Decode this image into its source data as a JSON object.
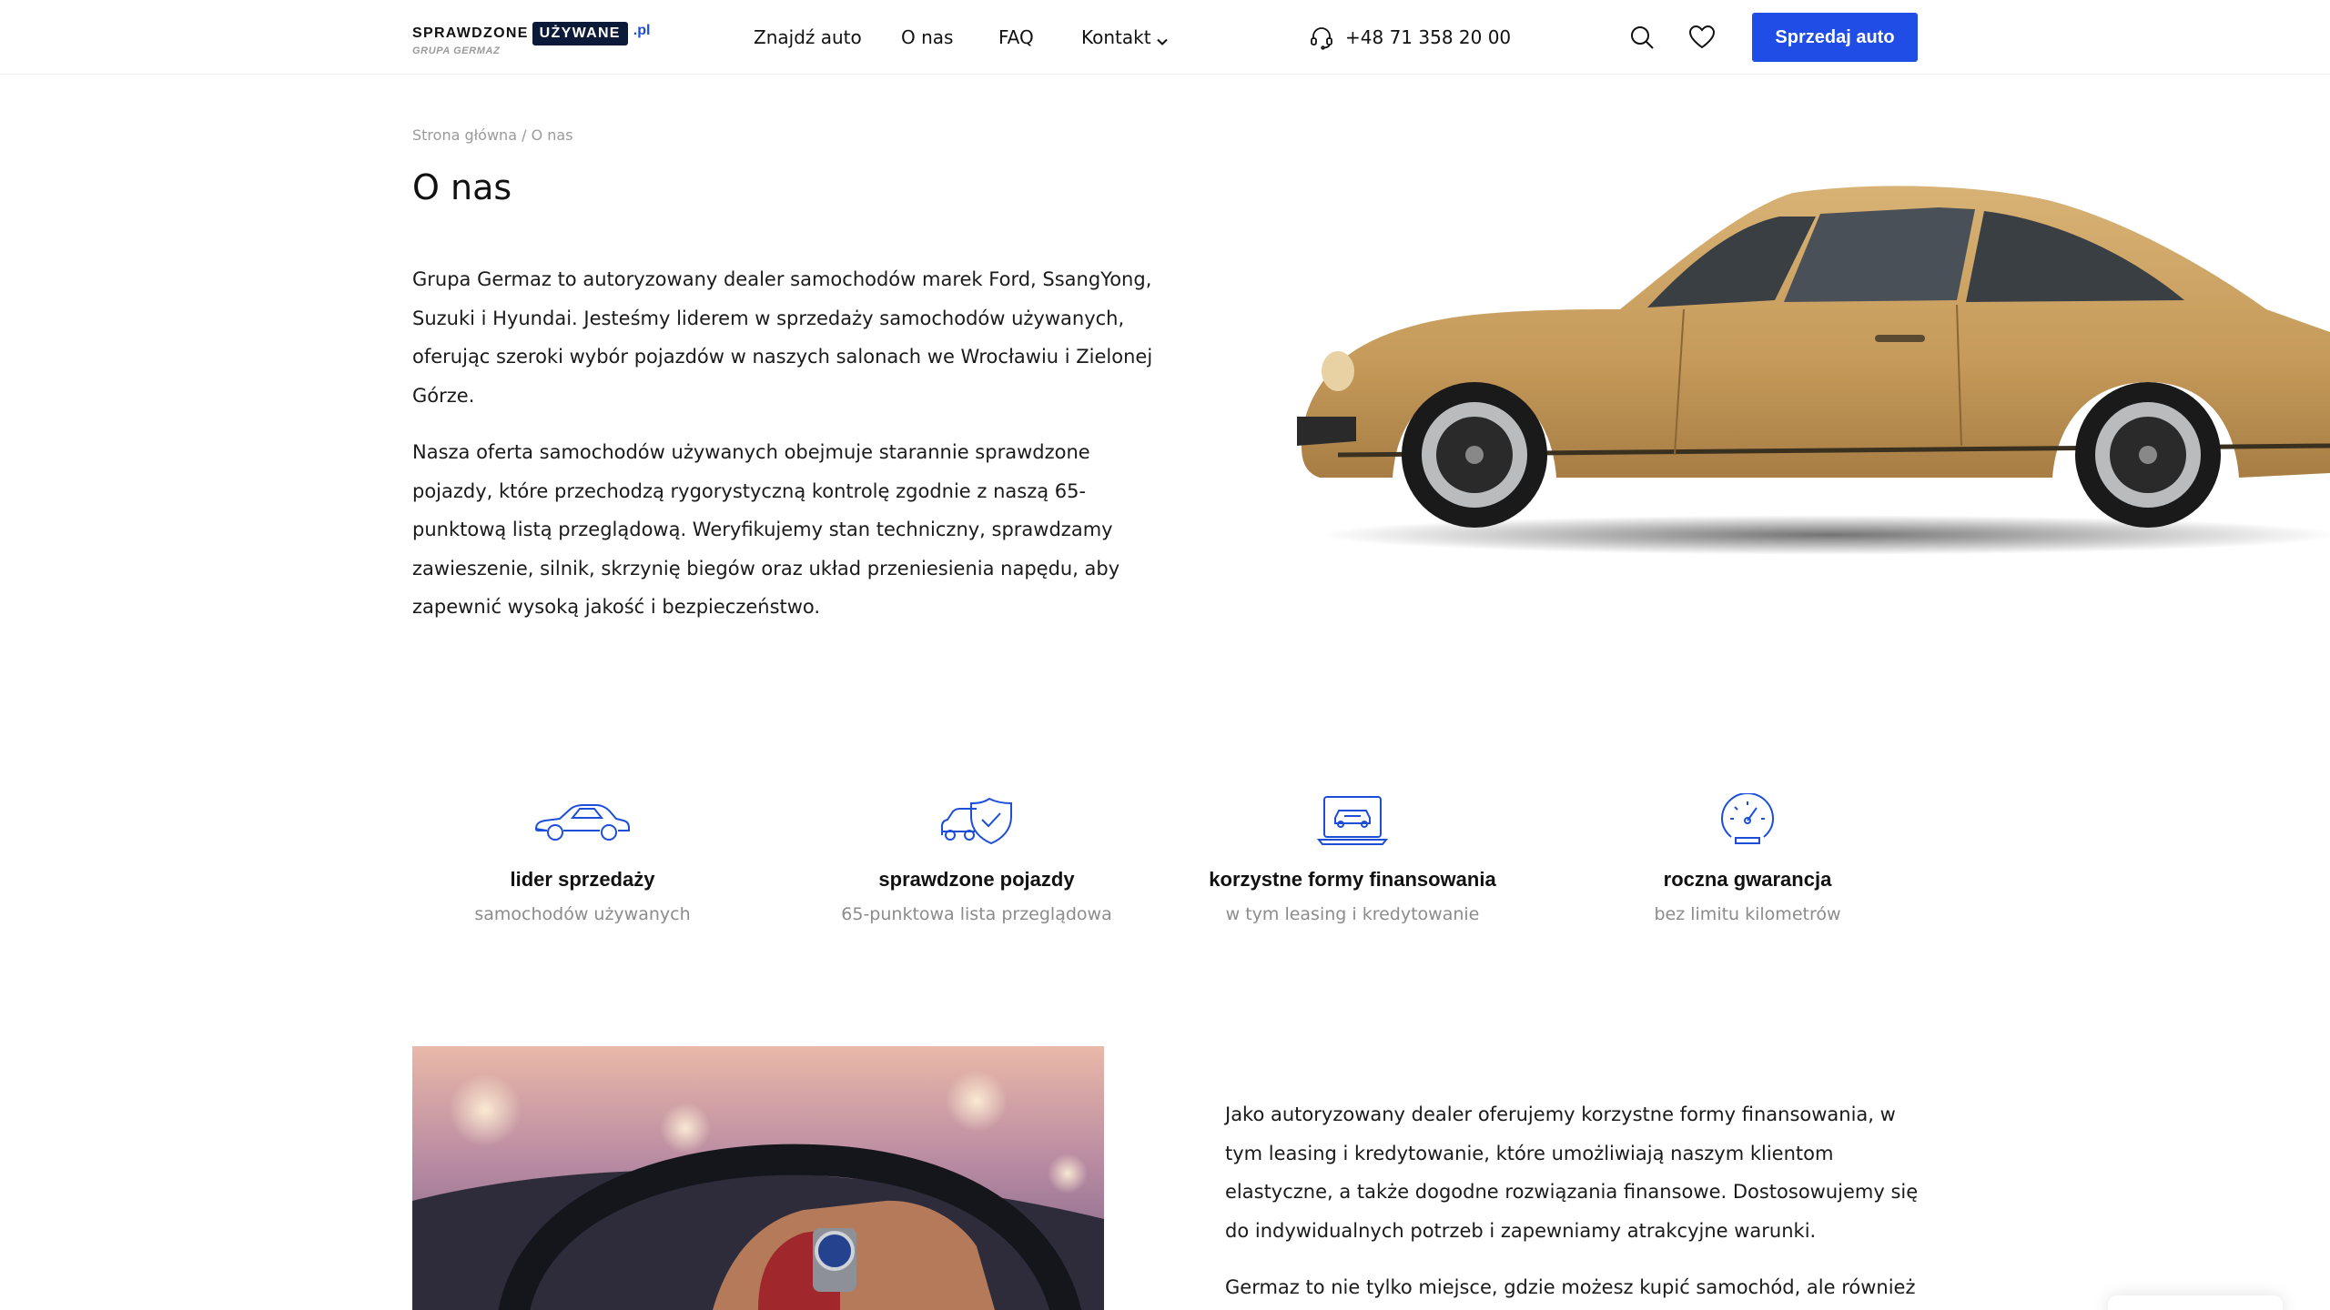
{
  "header": {
    "logo": {
      "part1": "SPRAWDZONE",
      "part2": "UŻYWANE",
      "part3": ".pl",
      "sub": "GRUPA GERMAZ"
    },
    "nav": [
      {
        "label": "Znajdź auto"
      },
      {
        "label": "O nas"
      },
      {
        "label": "FAQ"
      },
      {
        "label": "Kontakt"
      }
    ],
    "phone": "+48 71 358 20 00",
    "sell_label": "Sprzedaj auto",
    "icons": {
      "search": "search-icon",
      "favorites": "heart-icon",
      "phone": "headset-icon",
      "dropdown": "chevron-down-icon"
    }
  },
  "breadcrumb": "Strona główna / O nas",
  "title": "O nas",
  "intro": [
    "Grupa Germaz to autoryzowany dealer samochodów marek Ford, SsangYong, Suzuki i Hyundai. Jesteśmy liderem w sprzedaży samochodów używanych, oferując szeroki wybór pojazdów w naszych salonach we Wrocławiu i Zielonej Górze.",
    "Nasza oferta samochodów używanych obejmuje starannie sprawdzone pojazdy, które przechodzą rygorystyczną kontrolę zgodnie z naszą 65-punktową listą przeglądową. Weryfikujemy stan techniczny, sprawdzamy zawieszenie, silnik, skrzynię biegów oraz układ przeniesienia napędu, aby zapewnić wysoką jakość i bezpieczeństwo."
  ],
  "features": [
    {
      "icon": "car-icon",
      "title": "lider sprzedaży",
      "subtitle": "samochodów używanych"
    },
    {
      "icon": "car-shield-icon",
      "title": "sprawdzone pojazdy",
      "subtitle": "65-punktowa lista przeglądowa"
    },
    {
      "icon": "laptop-car-icon",
      "title": "korzystne formy finansowania",
      "subtitle": "w tym leasing i kredytowanie"
    },
    {
      "icon": "speedometer-icon",
      "title": "roczna gwarancja",
      "subtitle": "bez limitu kilometrów"
    }
  ],
  "bottom": [
    "Jako autoryzowany dealer oferujemy korzystne formy finansowania, w tym leasing i kredytowanie, które umożliwiają naszym klientom elastyczne, a także dogodne rozwiązania finansowe. Dostosowujemy się do indywidualnych potrzeb i zapewniamy atrakcyjne warunki.",
    "Germaz to nie tylko miejsce, gdzie możesz kupić samochód, ale również"
  ],
  "colors": {
    "accent": "#1f4de6",
    "logo_dark": "#0c1a3a",
    "icon_blue": "#1d4ed8",
    "muted": "#8c8c8c",
    "car_body": "#c9a062"
  }
}
